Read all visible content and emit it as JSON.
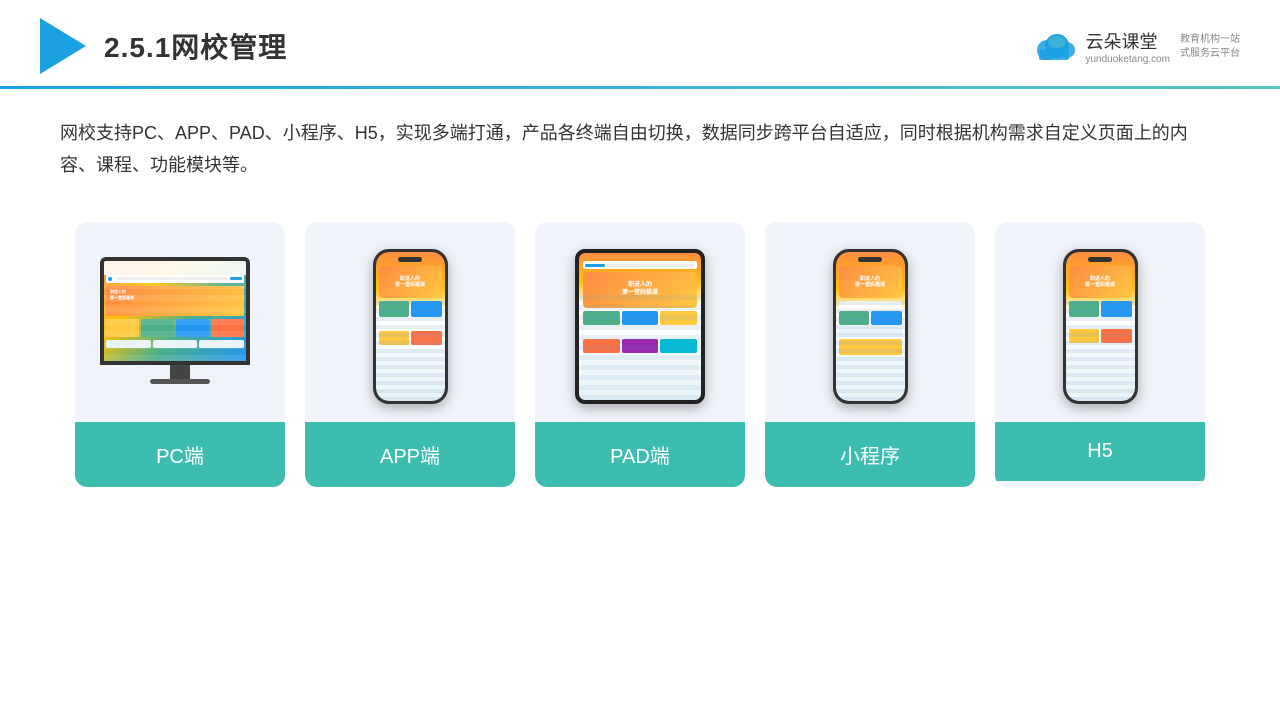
{
  "header": {
    "title": "2.5.1网校管理",
    "brand": {
      "name": "云朵课堂",
      "url": "yunduoketang.com",
      "tagline": "教育机构一站\n式服务云平台"
    }
  },
  "description": "网校支持PC、APP、PAD、小程序、H5，实现多端打通，产品各终端自由切换，数据同步跨平台自适应，同时根据机构需求自定义页面上的内容、课程、功能模块等。",
  "cards": [
    {
      "id": "pc",
      "label": "PC端",
      "type": "pc"
    },
    {
      "id": "app",
      "label": "APP端",
      "type": "phone"
    },
    {
      "id": "pad",
      "label": "PAD端",
      "type": "tablet"
    },
    {
      "id": "miniprogram",
      "label": "小程序",
      "type": "phone"
    },
    {
      "id": "h5",
      "label": "H5",
      "type": "phone"
    }
  ],
  "colors": {
    "accent_blue": "#1ba0e2",
    "accent_teal": "#3dbdb0",
    "gradient_start": "#1ba0e2",
    "gradient_end": "#5bc5c5"
  }
}
